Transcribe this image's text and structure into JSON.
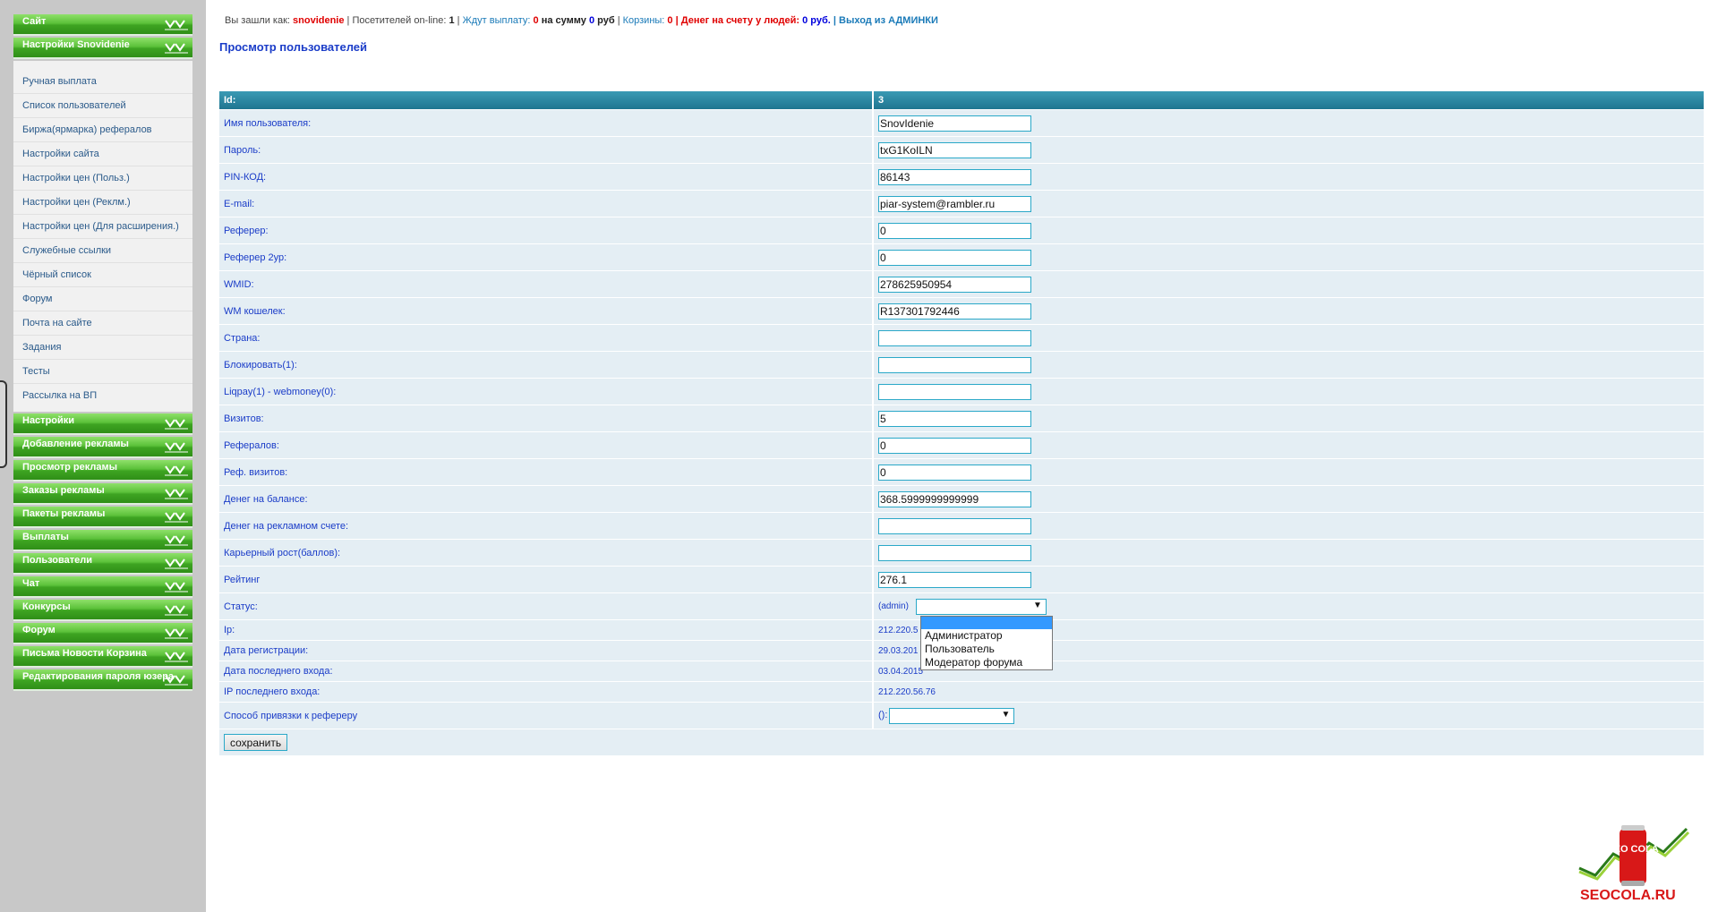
{
  "sidebar": {
    "top_sections": [
      "Сайт",
      "Настройки Snovidenie"
    ],
    "items": [
      "Ручная выплата",
      "Список пользователей",
      "Биржа(ярмарка) рефералов",
      "Настройки сайта",
      "Настройки цен (Польз.)",
      "Настройки цен (Реклм.)",
      "Настройки цен (Для расширения.)",
      "Служебные ссылки",
      "Чёрный список",
      "Форум",
      "Почта на сайте",
      "Задания",
      "Тесты",
      "Рассылка на ВП"
    ],
    "sections": [
      "Настройки",
      "Добавление рекламы",
      "Просмотр рекламы",
      "Заказы рекламы",
      "Пакеты рекламы",
      "Выплаты",
      "Пользователи",
      "Чат",
      "Конкурсы",
      "Форум",
      "Письма Новости Корзина",
      "Редактирования пароля юзера"
    ]
  },
  "topline": {
    "logged_as": "Вы зашли как:",
    "username": "snovidenie",
    "online_label": "| Посетителей on-line:",
    "online_count": "1",
    "pipe1": "|",
    "wait_label": "Ждут выплату:",
    "wait_count": "0",
    "sum_label": "на сумму",
    "sum_value": "0",
    "rub1": "руб",
    "pipe2": "|",
    "baskets_label": "Корзины:",
    "baskets_count": "0",
    "money_label": "| Денег на счету у людей:",
    "money_value": "0",
    "rub2": "руб.",
    "exit_label": "| Выход из АДМИНКИ"
  },
  "page_title": "Просмотр пользователей",
  "table": {
    "header_label": "Id:",
    "header_value": "3",
    "fields": [
      {
        "label": "Имя пользователя:",
        "value": "SnovIdenie"
      },
      {
        "label": "Пароль:",
        "value": "txG1KoILN"
      },
      {
        "label": "PIN-КОД:",
        "value": "86143"
      },
      {
        "label": "E-mail:",
        "value": "piar-system@rambler.ru"
      },
      {
        "label": "Реферер:",
        "value": "0"
      },
      {
        "label": "Реферер 2ур:",
        "value": "0"
      },
      {
        "label": "WMID:",
        "value": "278625950954"
      },
      {
        "label": "WM кошелек:",
        "value": "R137301792446"
      },
      {
        "label": "Страна:",
        "value": ""
      },
      {
        "label": "Блокировать(1):",
        "value": ""
      },
      {
        "label": "Liqpay(1) - webmoney(0):",
        "value": ""
      },
      {
        "label": "Визитов:",
        "value": "5"
      },
      {
        "label": "Рефералов:",
        "value": "0"
      },
      {
        "label": "Реф. визитов:",
        "value": "0"
      },
      {
        "label": "Денег на балансе:",
        "value": "368.5999999999999"
      },
      {
        "label": "Денег на рекламном счете:",
        "value": ""
      },
      {
        "label": "Карьерный рост(баллов):",
        "value": ""
      },
      {
        "label": "Рейтинг",
        "value": "276.1"
      }
    ],
    "status_label": "Статус:",
    "status_current": "(admin)",
    "status_options": [
      "Администратор",
      "Пользователь",
      "Модератор форума"
    ],
    "info": [
      {
        "label": "Ip:",
        "value": "212.220.5"
      },
      {
        "label": "Дата регистрации:",
        "value": "29.03.201"
      },
      {
        "label": "Дата последнего входа:",
        "value": "03.04.2015"
      },
      {
        "label": "IP последнего входа:",
        "value": "212.220.56.76"
      }
    ],
    "ref_binding_label": "Способ привязки к рефереру",
    "ref_binding_prefix": "():",
    "save_label": "сохранить"
  },
  "logo": {
    "can_text": "SEO COLA",
    "word": "SEOCOLA.RU"
  },
  "colors": {
    "accent_green": "#3ea422",
    "header_teal": "#1f7590",
    "title_blue": "#1a3cc8",
    "alert_red": "#e00000"
  }
}
